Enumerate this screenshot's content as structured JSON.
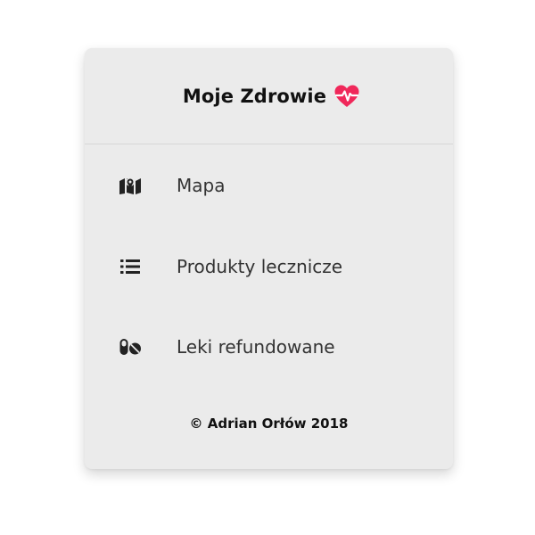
{
  "app": {
    "title": "Moje Zdrowie",
    "title_icon": "heartbeat-icon",
    "accent_color": "#f0285a"
  },
  "menu": {
    "items": [
      {
        "label": "Mapa",
        "icon": "map-icon"
      },
      {
        "label": "Produkty lecznicze",
        "icon": "list-icon"
      },
      {
        "label": "Leki refundowane",
        "icon": "pills-icon"
      }
    ]
  },
  "footer": {
    "copyright": "© Adrian Orłów 2018"
  }
}
